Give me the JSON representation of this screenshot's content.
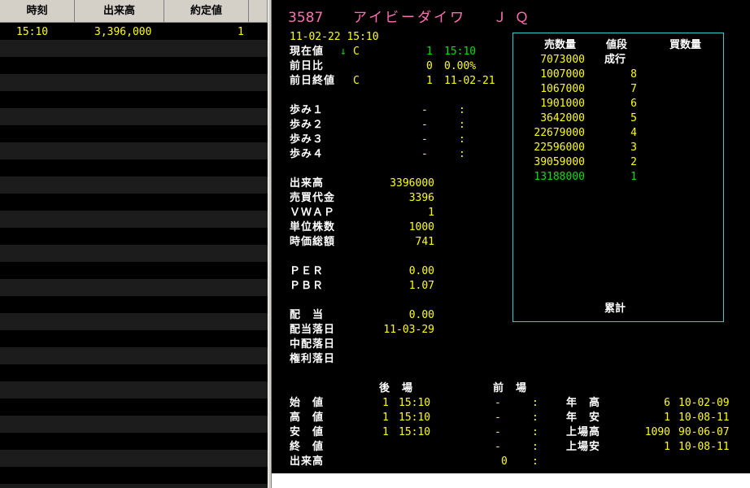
{
  "tick_list": {
    "headers": [
      "時刻",
      "出来高",
      "約定値"
    ],
    "rows": [
      {
        "time": "15:10",
        "volume": "3,396,000",
        "price": "1"
      }
    ]
  },
  "title": {
    "code": "3587",
    "name": "アイビーダイワ",
    "market": "ＪＱ"
  },
  "quote": {
    "datetime": "11-02-22 15:10",
    "current_label": "現在値",
    "current_arrow": "↓",
    "current_flag": "C",
    "current_price": "1",
    "current_time": "15:10",
    "change_label": "前日比",
    "change_value": "0",
    "change_pct": "0.00%",
    "prev_close_label": "前日終値",
    "prev_close_flag": "C",
    "prev_close_value": "1",
    "prev_close_date": "11-02-21"
  },
  "ayumi": [
    {
      "label": "歩み１",
      "price": "-",
      "time": ":"
    },
    {
      "label": "歩み２",
      "price": "-",
      "time": ":"
    },
    {
      "label": "歩み３",
      "price": "-",
      "time": ":"
    },
    {
      "label": "歩み４",
      "price": "-",
      "time": ":"
    }
  ],
  "stats": [
    {
      "label": "出来高",
      "value": "3396000"
    },
    {
      "label": "売買代金",
      "value": "3396"
    },
    {
      "label": "ＶＷＡＰ",
      "value": "1"
    },
    {
      "label": "単位株数",
      "value": "1000"
    },
    {
      "label": "時価総額",
      "value": "741"
    }
  ],
  "ratios": [
    {
      "label": "ＰＥＲ",
      "value": "0.00"
    },
    {
      "label": "ＰＢＲ",
      "value": "1.07"
    }
  ],
  "dividend": [
    {
      "label": "配　当",
      "value": "0.00"
    },
    {
      "label": "配当落日",
      "value": "11-03-29"
    },
    {
      "label": "中配落日",
      "value": ""
    },
    {
      "label": "権利落日",
      "value": ""
    }
  ],
  "session": {
    "header_after": "後　場",
    "header_before": "前　場",
    "rows": [
      {
        "label": "始　値",
        "after_price": "1",
        "after_time": "15:10",
        "before_price": "-",
        "before_time": ":"
      },
      {
        "label": "高　値",
        "after_price": "1",
        "after_time": "15:10",
        "before_price": "-",
        "before_time": ":"
      },
      {
        "label": "安　値",
        "after_price": "1",
        "after_time": "15:10",
        "before_price": "-",
        "before_time": ":"
      },
      {
        "label": "終　値",
        "after_price": "",
        "after_time": "",
        "before_price": "-",
        "before_time": ":"
      },
      {
        "label": "出来高",
        "after_price": "",
        "after_time": "",
        "before_price": "0",
        "before_time": ":"
      }
    ]
  },
  "range": [
    {
      "label": "年　高",
      "value": "6",
      "date": "10-02-09"
    },
    {
      "label": "年　安",
      "value": "1",
      "date": "10-08-11"
    },
    {
      "label": "上場高",
      "value": "1090",
      "date": "90-06-07"
    },
    {
      "label": "上場安",
      "value": "1",
      "date": "10-08-11"
    }
  ],
  "order_book": {
    "headers": [
      "売数量",
      "値段",
      "買数量"
    ],
    "market_order": {
      "sell": "7073000",
      "price": "成行"
    },
    "rows": [
      {
        "sell": "1007000",
        "price": "8",
        "buy": ""
      },
      {
        "sell": "1067000",
        "price": "7",
        "buy": ""
      },
      {
        "sell": "1901000",
        "price": "6",
        "buy": ""
      },
      {
        "sell": "3642000",
        "price": "5",
        "buy": ""
      },
      {
        "sell": "22679000",
        "price": "4",
        "buy": ""
      },
      {
        "sell": "22596000",
        "price": "3",
        "buy": ""
      },
      {
        "sell": "39059000",
        "price": "2",
        "buy": ""
      },
      {
        "sell": "13188000",
        "price": "1",
        "buy": ""
      }
    ],
    "total_label": "累計"
  },
  "colors": {
    "label": "#ffffff",
    "value": "#ffff00",
    "highlight": "#00e000",
    "title": "#ff6fb4",
    "book_border": "#33cccc"
  }
}
